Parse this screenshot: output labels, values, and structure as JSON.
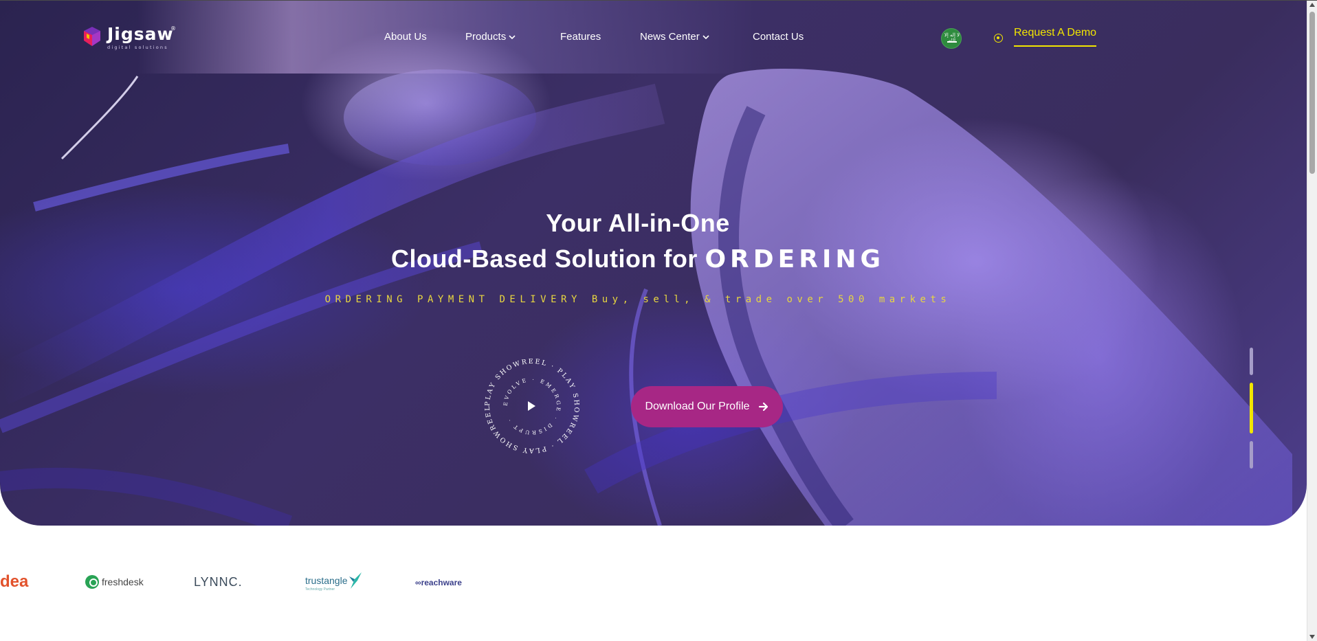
{
  "brand": {
    "name": "Jigsaw",
    "tagline": "digital solutions",
    "registered": "®"
  },
  "nav": {
    "items": [
      {
        "label": "About Us",
        "has_dropdown": false
      },
      {
        "label": "Products",
        "has_dropdown": true
      },
      {
        "label": "Features",
        "has_dropdown": false
      },
      {
        "label": "News Center",
        "has_dropdown": true
      },
      {
        "label": "Contact Us",
        "has_dropdown": false
      }
    ],
    "language_flag": {
      "icon": "saudi-flag-icon",
      "text": "لا إله إلا الله"
    },
    "cta": "Request A Demo"
  },
  "hero": {
    "headline_line1": "Your All-in-One",
    "headline_line2": "Cloud-Based Solution for",
    "rotating_word": "ORDERING",
    "subline": "ORDERING PAYMENT DELIVERY Buy, sell, & trade over 500 markets",
    "showreel": {
      "ring_text": "PLAY SHOWREEL · PLAY SHOWREEL · PLAY SHOWREEL ·",
      "inner_text": "EVOLVE · EMERGE · DISRUPT ·",
      "icon": "play-icon"
    },
    "download_button": "Download Our Profile",
    "slides": {
      "count": 3,
      "active_index": 1
    }
  },
  "partners": [
    {
      "name": "dea"
    },
    {
      "name": "freshdesk"
    },
    {
      "name": "LYNNC."
    },
    {
      "name": "trustangle",
      "tag": "Technology Partner"
    },
    {
      "name": "reachware"
    }
  ],
  "colors": {
    "hero_bg": "#3c2f66",
    "accent_yellow": "#f2e600",
    "button_magenta": "#a72785",
    "subline_yellow": "#e8d640"
  }
}
